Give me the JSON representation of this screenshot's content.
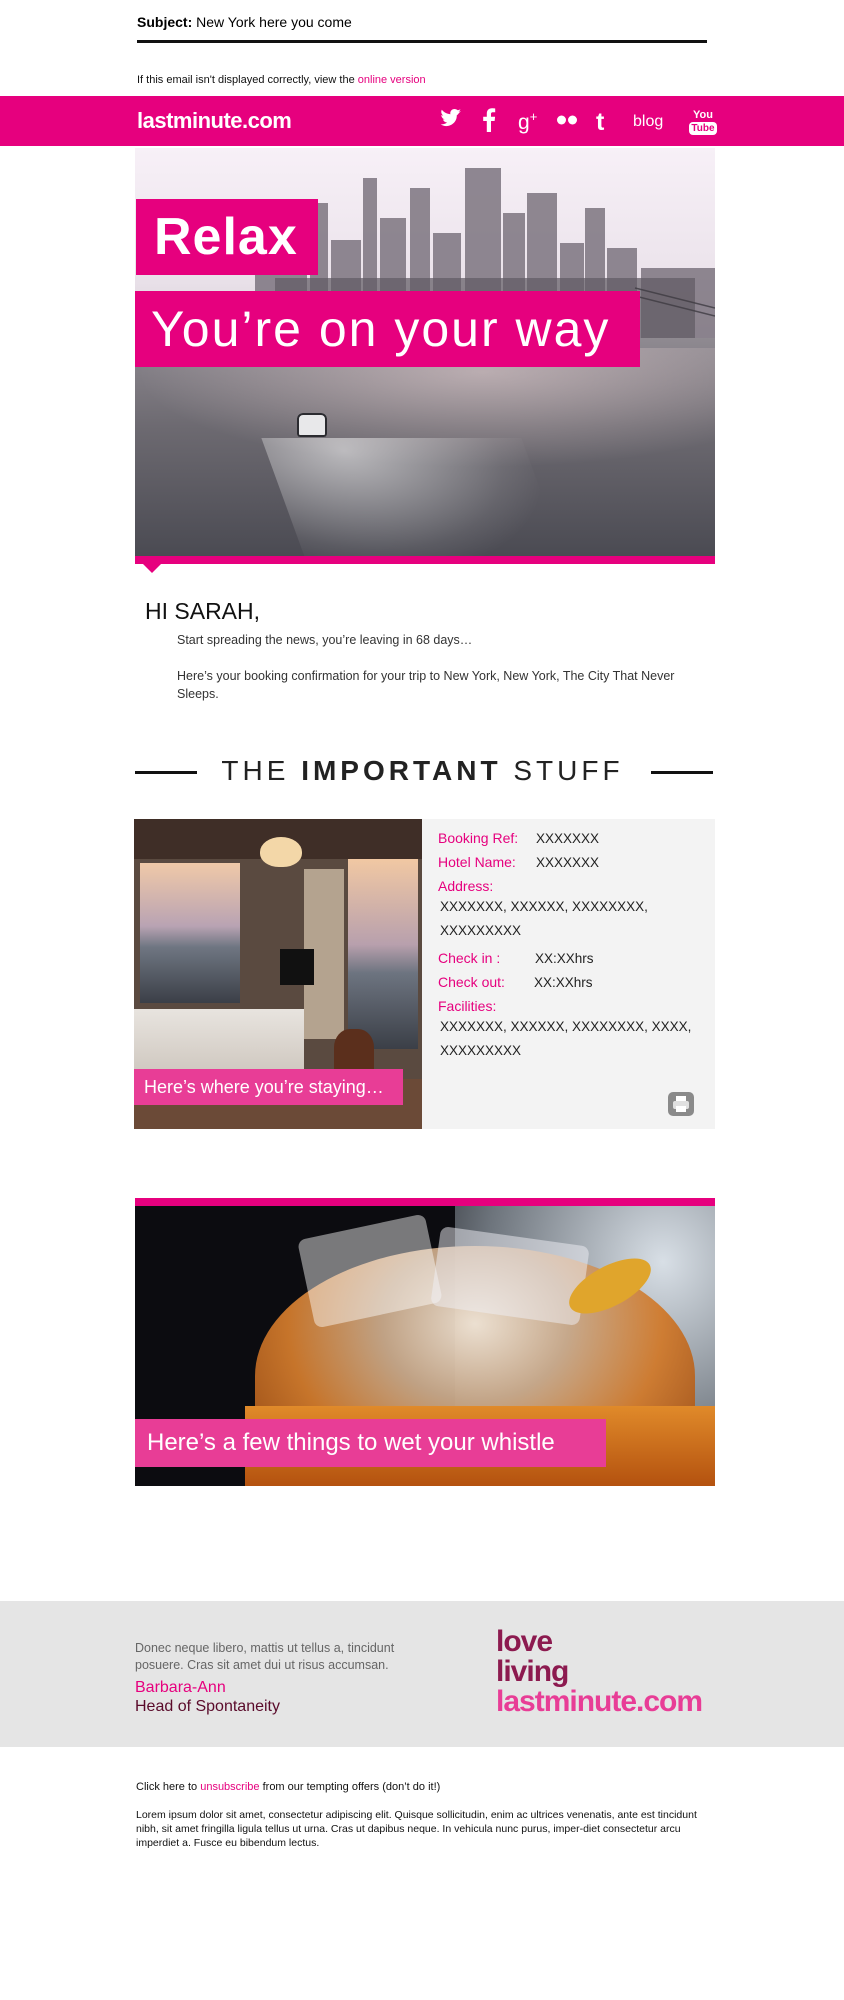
{
  "subject": {
    "label": "Subject:",
    "text": "New York here you come"
  },
  "preheader": {
    "text": "If this email isn't displayed correctly, view the",
    "link": "online version"
  },
  "header": {
    "logo": "lastminute.com",
    "social": {
      "blog": "blog",
      "youtube_top": "You",
      "youtube_bottom": "Tube"
    },
    "icons": [
      "twitter-icon",
      "facebook-icon",
      "google-plus-icon",
      "flickr-icon",
      "tumblr-icon",
      "blog-link",
      "youtube-icon"
    ]
  },
  "hero": {
    "line1": "Relax",
    "line2": "You’re on your way"
  },
  "greeting": {
    "salutation": "HI SARAH,",
    "line1": "Start spreading the news, you’re leaving in 68 days…",
    "line2": "Here’s your booking confirmation for your trip to New York, New York, The City That Never Sleeps."
  },
  "section": {
    "pre": "THE",
    "bold": "IMPORTANT",
    "post": "STUFF"
  },
  "hotel": {
    "caption": "Here’s where you’re staying…",
    "booking_ref_label": "Booking Ref:",
    "booking_ref_value": "XXXXXXX",
    "hotel_name_label": "Hotel Name:",
    "hotel_name_value": "XXXXXXX",
    "address_label": "Address:",
    "address_line1": "XXXXXXX, XXXXXX, XXXXXXXX,",
    "address_line2": "XXXXXXXXX",
    "checkin_label": "Check in :",
    "checkin_value": "XX:XXhrs",
    "checkout_label": "Check out:",
    "checkout_value": "XX:XXhrs",
    "facilities_label": "Facilities:",
    "facilities_line1": "XXXXXXX, XXXXXX, XXXXXXXX, XXXX,",
    "facilities_line2": "XXXXXXXXX"
  },
  "drink": {
    "caption": "Here’s a few things to wet your whistle"
  },
  "footer": {
    "quote": "Donec neque libero, mattis ut tellus a, tincidunt posuere. Cras sit amet dui ut risus accumsan.",
    "sig_name": "Barbara-Ann",
    "sig_title": "Head of Spontaneity",
    "tag1": "love",
    "tag2": "living",
    "tag3": "lastminute.com",
    "colors": {
      "pink": "#e6007e",
      "plum": "#8c1a4f"
    }
  },
  "legal": {
    "unsub_pre": "Click  here to",
    "unsub_link": "unsubscribe",
    "unsub_post": "from our tempting offers (don’t do it!)",
    "body": "Lorem ipsum dolor sit amet, consectetur adipiscing elit. Quisque sollicitudin, enim ac ultrices venenatis, ante est tincidunt nibh, sit amet fringilla ligula tellus ut urna. Cras ut dapibus neque. In vehicula nunc purus, imper-diet consectetur arcu imperdiet a. Fusce eu bibendum lectus."
  },
  "brand_color": "#e6007e"
}
